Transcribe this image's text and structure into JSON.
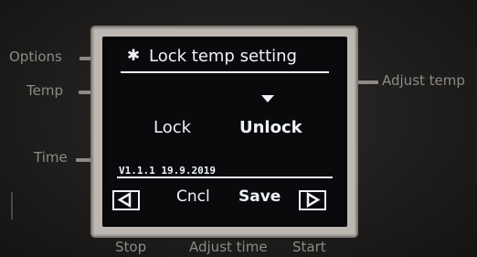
{
  "device_panel": {
    "left_labels": [
      "Options",
      "Temp",
      "Time"
    ],
    "right_label": "Adjust temp",
    "bottom_labels": [
      "Stop",
      "Adjust time",
      "Start"
    ]
  },
  "screen": {
    "title_icon": "gear-icon",
    "title": "Lock temp setting",
    "options": [
      "Lock",
      "Unlock"
    ],
    "selected_option": "Unlock",
    "version": "V1.1.1 19.9.2019",
    "footer": {
      "left_arrow_icon": "left-arrow-icon",
      "cancel_label": "Cncl",
      "save_label": "Save",
      "right_arrow_icon": "right-arrow-icon"
    }
  },
  "colors": {
    "screen_text": "#eef3ff",
    "screen_bg": "#0a0a0c",
    "panel_label": "#8d8a86",
    "bezel": "#bdb8b2"
  }
}
